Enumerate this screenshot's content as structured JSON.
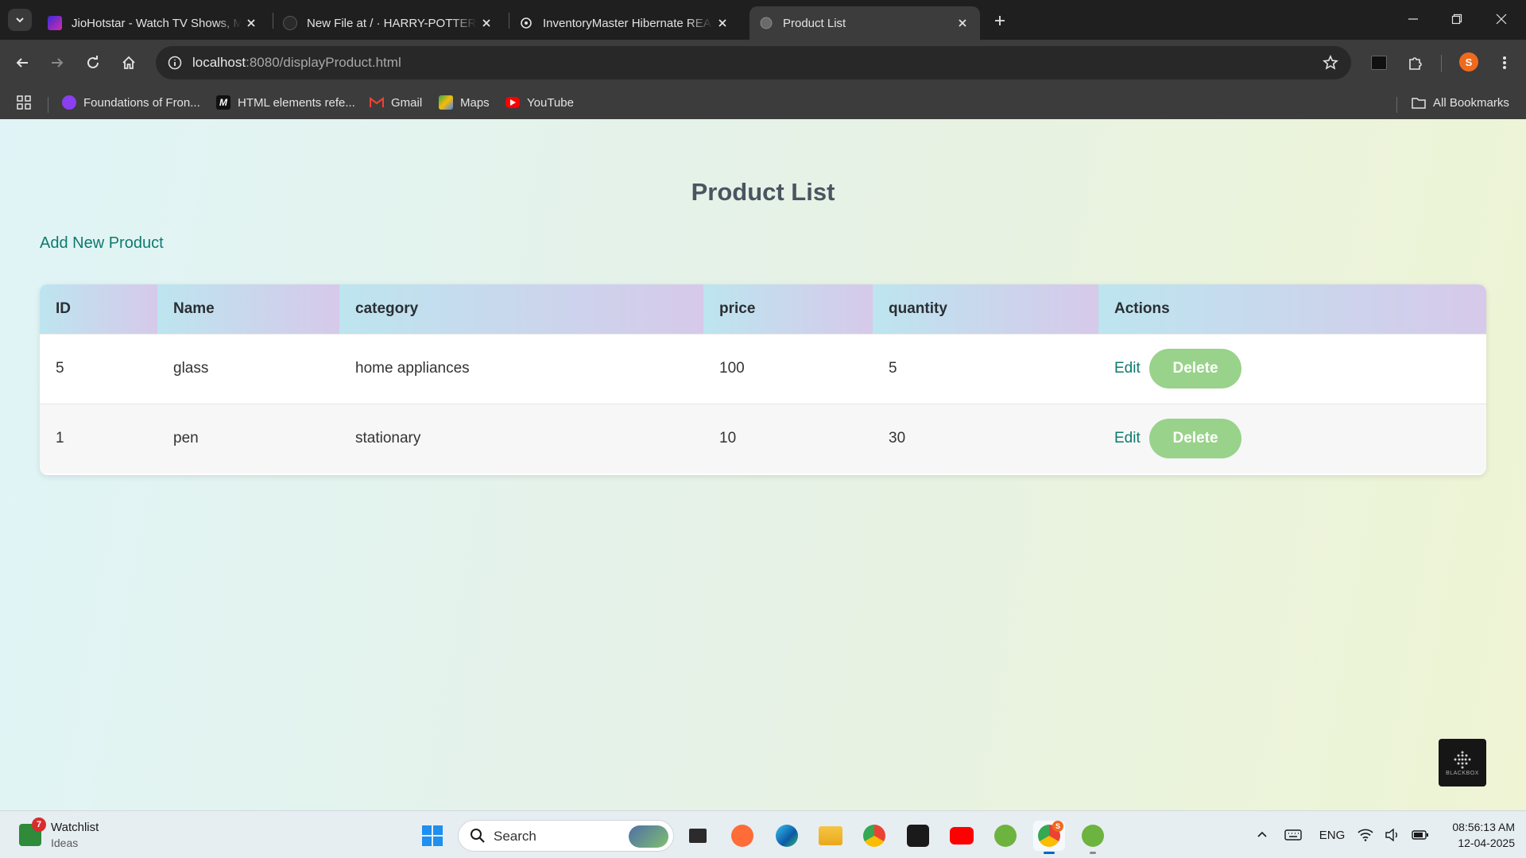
{
  "browser": {
    "tabs": [
      {
        "title": "JioHotstar - Watch TV Shows, Movies",
        "active": false
      },
      {
        "title": "New File at / · HARRY-POTTER-WEB",
        "active": false
      },
      {
        "title": "InventoryMaster Hibernate REACT",
        "active": false
      },
      {
        "title": "Product List",
        "active": true
      }
    ],
    "url_host": "localhost",
    "url_rest": ":8080/displayProduct.html",
    "profile_initial": "S",
    "bookmarks": [
      {
        "label": "Foundations of Fron...",
        "icon": "foundations-icon"
      },
      {
        "label": "HTML elements refe...",
        "icon": "mdn-icon"
      },
      {
        "label": "Gmail",
        "icon": "gmail-icon"
      },
      {
        "label": "Maps",
        "icon": "maps-icon"
      },
      {
        "label": "YouTube",
        "icon": "youtube-icon"
      }
    ],
    "all_bookmarks_label": "All Bookmarks"
  },
  "page": {
    "title": "Product List",
    "add_link": "Add New Product",
    "table": {
      "headers": [
        "ID",
        "Name",
        "category",
        "price",
        "quantity",
        "Actions"
      ],
      "rows": [
        {
          "id": "5",
          "name": "glass",
          "category": "home appliances",
          "price": "100",
          "quantity": "5"
        },
        {
          "id": "1",
          "name": "pen",
          "category": "stationary",
          "price": "10",
          "quantity": "30"
        }
      ],
      "edit_label": "Edit",
      "delete_label": "Delete"
    },
    "widget_label": "BLACKBOX"
  },
  "taskbar": {
    "watchlist_title": "Watchlist",
    "watchlist_sub": "Ideas",
    "watchlist_badge": "7",
    "search_placeholder": "Search",
    "chrome_badge": "S",
    "language": "ENG",
    "time": "08:56:13 AM",
    "date": "12-04-2025"
  },
  "colors": {
    "accent_link": "#0e7a6d",
    "delete_button": "#99d28a",
    "header_gradient_start": "#bde5ef",
    "header_gradient_end": "#d6c9ea"
  }
}
